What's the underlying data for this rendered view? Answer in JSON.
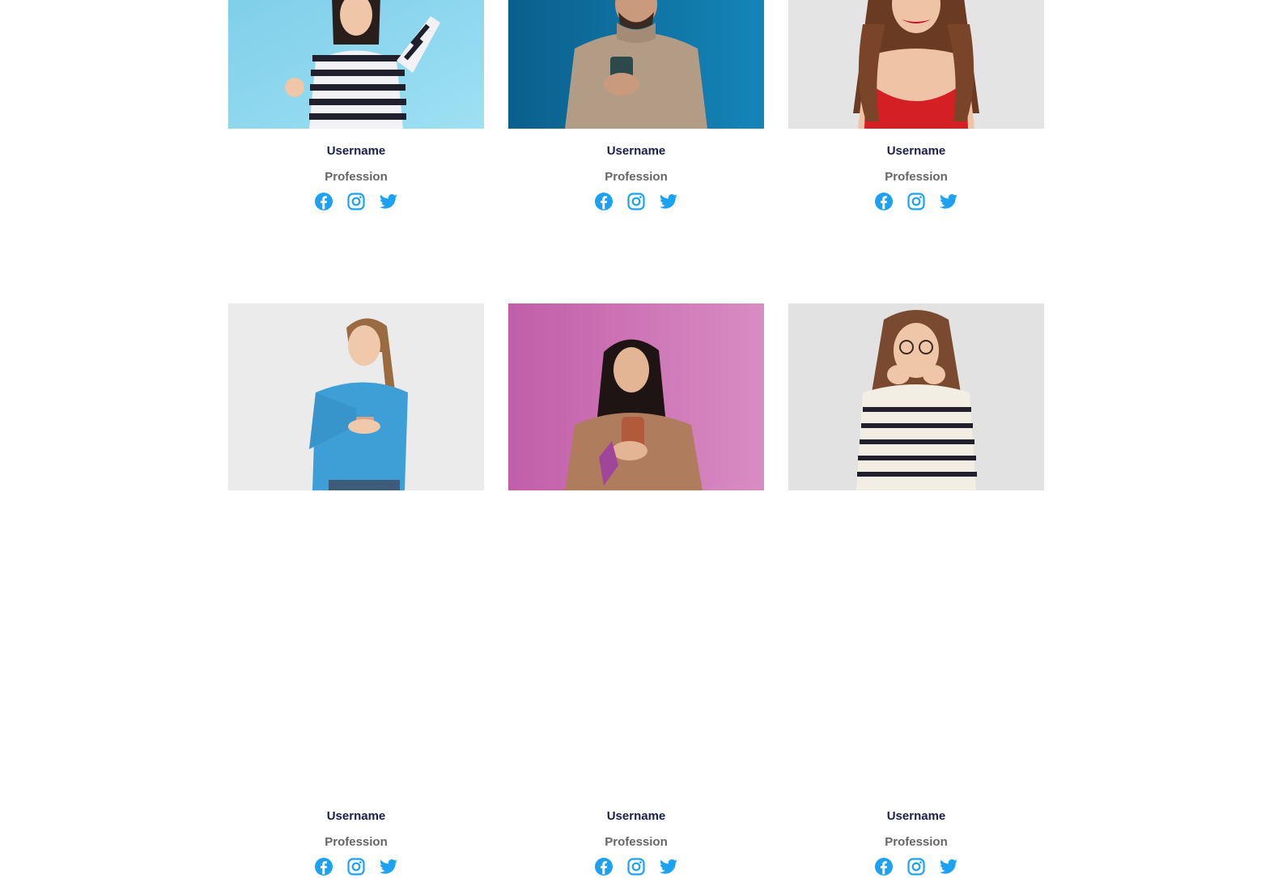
{
  "colors": {
    "accent": "#1da1f2",
    "username": "#1a1f4d",
    "profession": "#666666"
  },
  "icons": [
    "facebook-icon",
    "instagram-icon",
    "twitter-icon"
  ],
  "team": [
    {
      "username": "Username",
      "profession": "Profession",
      "photo_bg": "#8fd6ee"
    },
    {
      "username": "Username",
      "profession": "Profession",
      "photo_bg": "#0f6e9e"
    },
    {
      "username": "Username",
      "profession": "Profession",
      "photo_bg": "#e4e4e4"
    },
    {
      "username": "Username",
      "profession": "Profession",
      "photo_bg": "#ebebeb"
    },
    {
      "username": "Username",
      "profession": "Profession",
      "photo_bg": "#c86bb0"
    },
    {
      "username": "Username",
      "profession": "Profession",
      "photo_bg": "#e2e2e2"
    }
  ]
}
